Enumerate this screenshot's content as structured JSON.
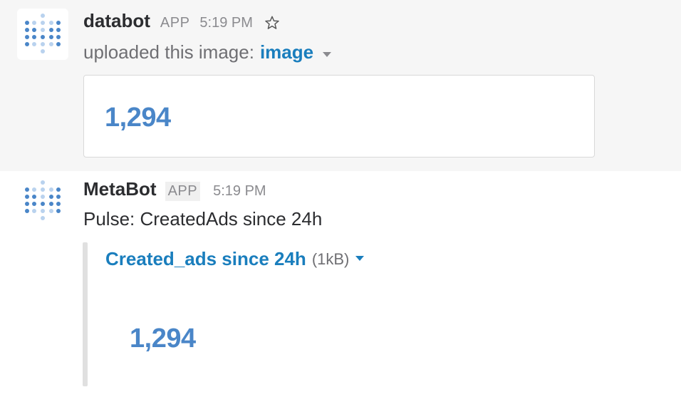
{
  "messages": [
    {
      "sender": "databot",
      "badge": "APP",
      "time": "5:19 PM",
      "upload_prefix": "uploaded this image:",
      "file_link": "image",
      "preview_value": "1,294"
    },
    {
      "sender": "MetaBot",
      "badge": "APP",
      "time": "5:19 PM",
      "text": "Pulse: CreatedAds since 24h",
      "attachment": {
        "title": "Created_ads since 24h",
        "size": "(1kB)",
        "value": "1,294"
      }
    }
  ],
  "colors": {
    "link": "#1a7ebd",
    "value": "#4a86c8",
    "avatar_dot": "#4a86c8",
    "avatar_dot_light": "#b9d2ee"
  },
  "icons": [
    "metabase-logo-icon",
    "star-icon",
    "caret-down-icon"
  ]
}
